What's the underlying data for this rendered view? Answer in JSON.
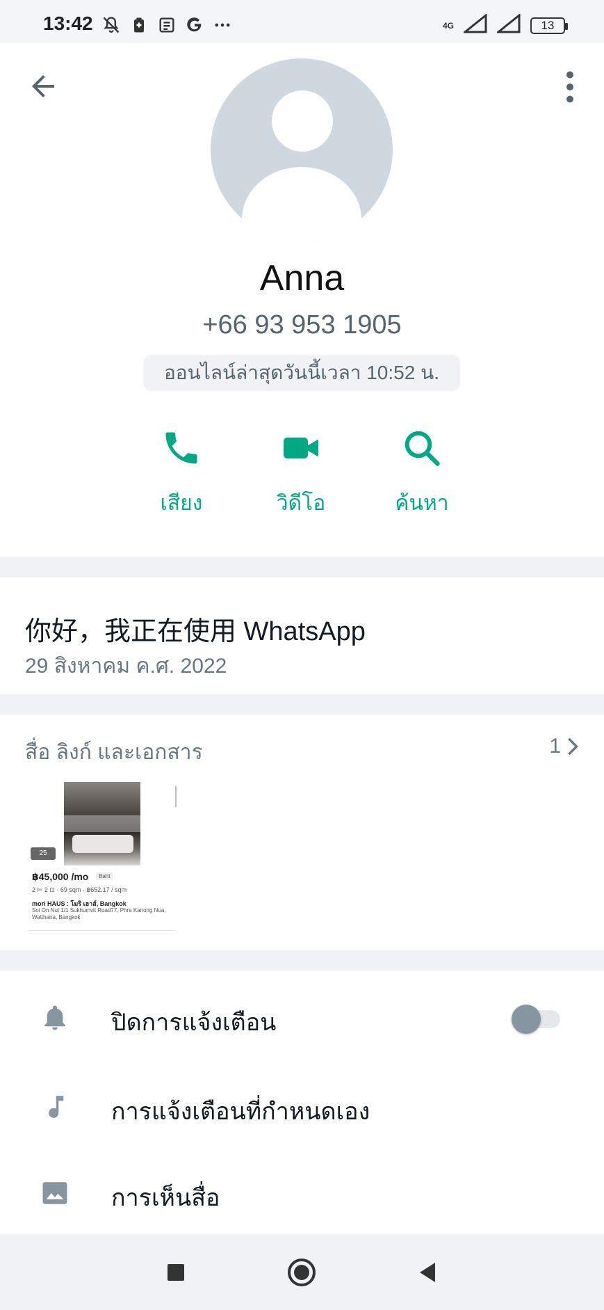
{
  "status_bar": {
    "time": "13:42",
    "network": "4G",
    "battery": "13"
  },
  "header": {
    "back_icon": "arrow-left-icon",
    "menu_icon": "more-vert-icon"
  },
  "contact": {
    "name": "Anna",
    "phone": "+66 93 953 1905",
    "last_seen": "ออนไลน์ล่าสุดวันนี้เวลา 10:52 น."
  },
  "actions": [
    {
      "label": "เสียง",
      "icon": "phone-icon"
    },
    {
      "label": "วิดีโอ",
      "icon": "video-icon"
    },
    {
      "label": "ค้นหา",
      "icon": "search-icon"
    }
  ],
  "about": {
    "text": "你好，我正在使用 WhatsApp",
    "date": "29 สิงหาคม ค.ศ. 2022"
  },
  "media": {
    "title": "สื่อ ลิงก์ และเอกสาร",
    "count": "1",
    "thumbnail": {
      "photo_count": "25",
      "price": "฿45,000 /mo",
      "badge": "Baht",
      "specs": "2 ⊨  2 ⊡  ·  69 sqm  ·  ฿652.17 / sqm",
      "name": "mori HAUS : โมริ เฮาส์, Bangkok",
      "address": "Soi On Nut 1/1 Sukhumvit Road77, Phra Kanong Nua, Watthana, Bangkok"
    }
  },
  "settings": {
    "mute_label": "ปิดการแจ้งเตือน",
    "mute_on": false,
    "custom_notif_label": "การแจ้งเตือนที่กำหนดเอง",
    "media_visibility_label": "การเห็นสื่อ"
  },
  "colors": {
    "accent": "#00a884",
    "secondary_text": "#667781",
    "icon_gray": "#8696a0"
  }
}
